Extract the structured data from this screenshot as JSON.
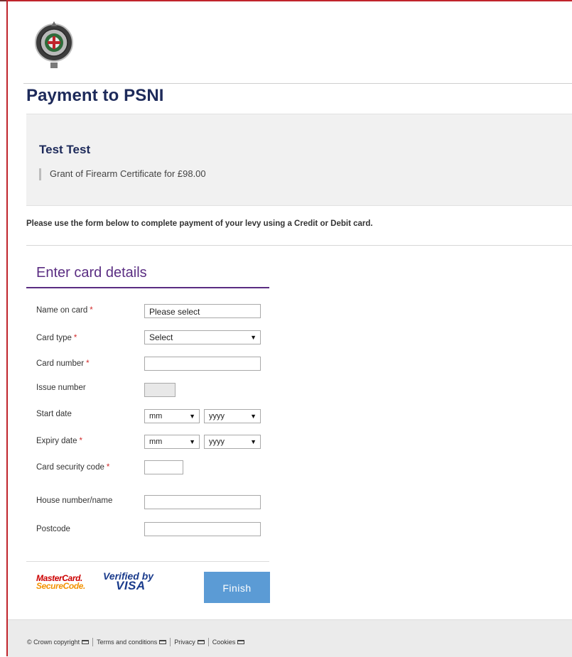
{
  "page": {
    "title": "Payment to PSNI"
  },
  "summary": {
    "payer_name": "Test Test",
    "item": "Grant of Firearm Certificate for £98.00"
  },
  "instructions": "Please use the form below to complete payment of your levy using a Credit or Debit card.",
  "form": {
    "heading": "Enter card details",
    "required_marker": "*",
    "name_on_card": {
      "label": "Name on card",
      "value": "Please select"
    },
    "card_type": {
      "label": "Card type",
      "selected": "Select"
    },
    "card_number": {
      "label": "Card number",
      "value": ""
    },
    "issue_number": {
      "label": "Issue number",
      "value": ""
    },
    "start_date": {
      "label": "Start date",
      "month": "mm",
      "year": "yyyy"
    },
    "expiry_date": {
      "label": "Expiry date",
      "month": "mm",
      "year": "yyyy"
    },
    "security_code": {
      "label": "Card security code",
      "value": ""
    },
    "house": {
      "label": "House number/name",
      "value": ""
    },
    "postcode": {
      "label": "Postcode",
      "value": ""
    },
    "finish_label": "Finish"
  },
  "logos": {
    "mastercard_line1": "MasterCard.",
    "mastercard_line2": "SecureCode.",
    "visa_line1": "Verified by",
    "visa_line2": "VISA"
  },
  "footer": {
    "copyright": "© Crown copyright",
    "terms": "Terms and conditions",
    "privacy": "Privacy",
    "cookies": "Cookies"
  },
  "colors": {
    "brand_navy": "#1d2a5a",
    "heading_purple": "#5a2d82",
    "button_blue": "#5b9bd5",
    "frame_red": "#c0242b",
    "required_red": "#d22b2b"
  },
  "icons": [
    "psni-crest-logo",
    "dropdown-arrow-icon",
    "external-link-icon"
  ]
}
